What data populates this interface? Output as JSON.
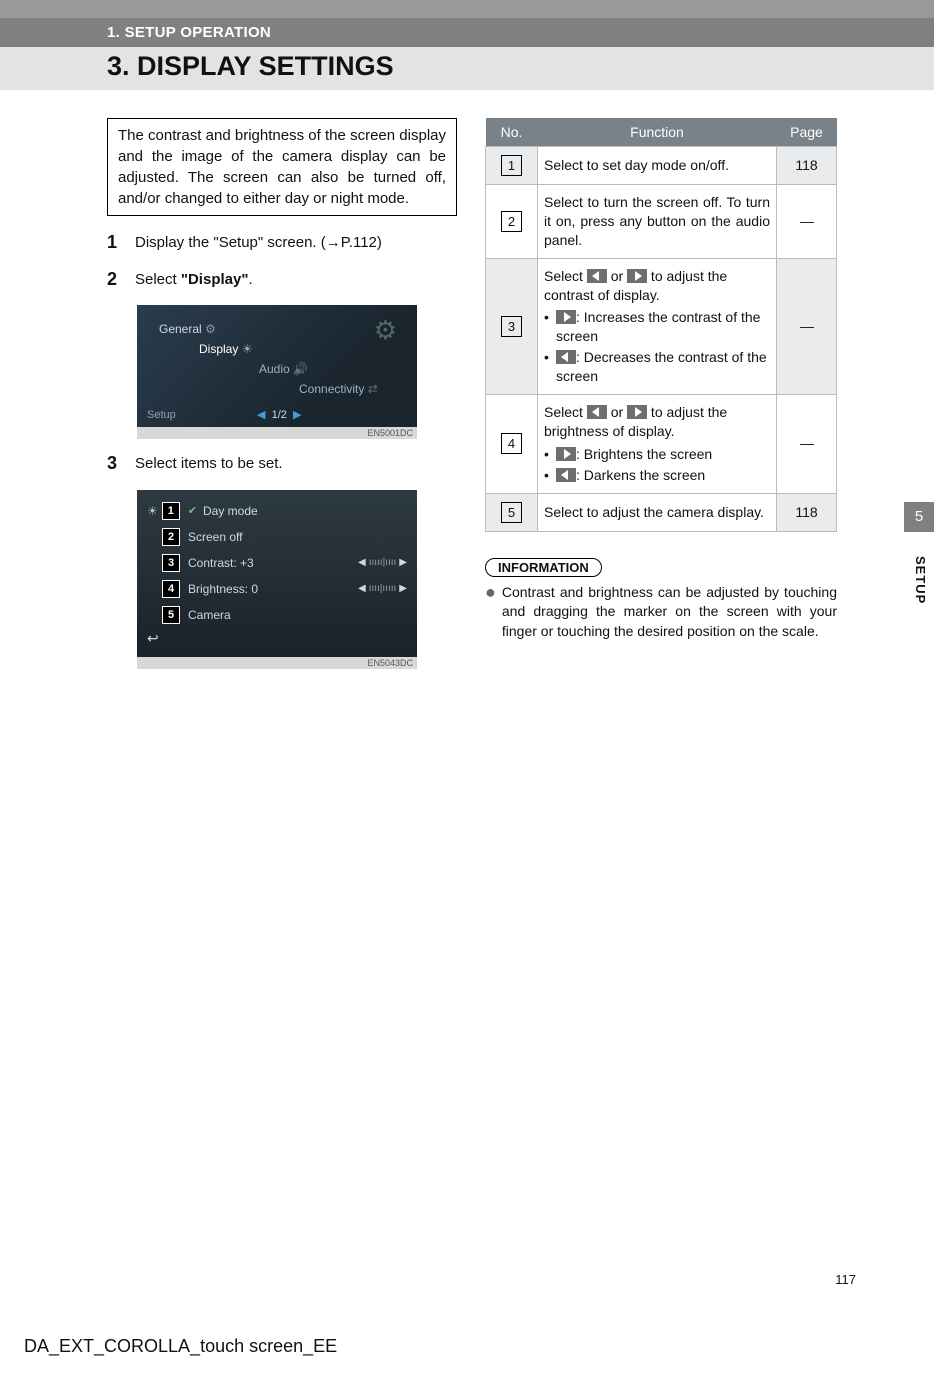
{
  "header": {
    "section": "1. SETUP OPERATION",
    "title": "3. DISPLAY SETTINGS"
  },
  "intro": "The contrast and brightness of the screen display and the image of the camera display can be adjusted. The screen can also be turned off, and/or changed to either day or night mode.",
  "steps": {
    "s1_pre": "Display the \"Setup\" screen. (",
    "s1_ref": "P.112",
    "s1_post": ")",
    "s2_pre": "Select ",
    "s2_bold": "\"Display\"",
    "s2_post": ".",
    "s3": "Select items to be set."
  },
  "screenshot1": {
    "items": [
      "General",
      "Display",
      "Audio",
      "Connectivity"
    ],
    "footer_label": "Setup",
    "pager": "1/2",
    "code": "EN5001DC"
  },
  "screenshot2": {
    "rows": [
      {
        "n": "1",
        "label": "Day mode",
        "check": true,
        "slider": false,
        "gear": true
      },
      {
        "n": "2",
        "label": "Screen off",
        "check": false,
        "slider": false,
        "gear": false
      },
      {
        "n": "3",
        "label": "Contrast: +3",
        "check": false,
        "slider": true,
        "gear": false
      },
      {
        "n": "4",
        "label": "Brightness: 0",
        "check": false,
        "slider": true,
        "gear": false
      },
      {
        "n": "5",
        "label": "Camera",
        "check": false,
        "slider": false,
        "gear": false
      }
    ],
    "code": "EN5043DC"
  },
  "table": {
    "head": {
      "no": "No.",
      "fn": "Function",
      "pg": "Page"
    },
    "rows": [
      {
        "n": "1",
        "fn_plain": "Select to set day mode on/off.",
        "pg": "118"
      },
      {
        "n": "2",
        "fn_plain": "Select to turn the screen off. To turn it on, press any button on the audio panel.",
        "pg": "—"
      },
      {
        "n": "3",
        "fn_lead_pre": "Select ",
        "fn_lead_mid": " or ",
        "fn_lead_post": " to adjust the contrast of display.",
        "b1": ": Increases the contrast of the screen",
        "b2": ": Decreases the contrast of the screen",
        "pg": "—"
      },
      {
        "n": "4",
        "fn_lead_pre": "Select ",
        "fn_lead_mid": " or ",
        "fn_lead_post": " to adjust the brightness of display.",
        "b1": ": Brightens the screen",
        "b2": ": Darkens the screen",
        "pg": "—"
      },
      {
        "n": "5",
        "fn_plain": "Select to adjust the camera display.",
        "pg": "118"
      }
    ]
  },
  "info": {
    "label": "INFORMATION",
    "text": "Contrast and brightness can be adjusted by touching and dragging the marker on the screen with your finger or touching the desired position on the scale."
  },
  "side": {
    "chapter": "5",
    "label": "SETUP"
  },
  "page_number": "117",
  "footer": "DA_EXT_COROLLA_touch screen_EE"
}
